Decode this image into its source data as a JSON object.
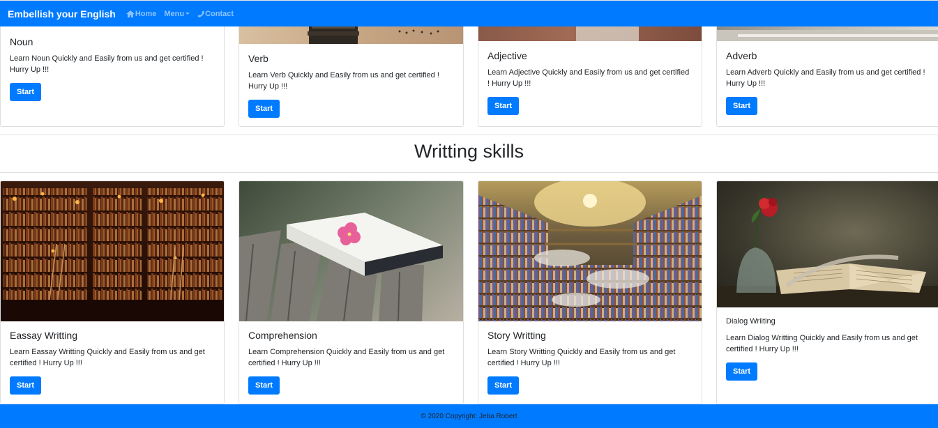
{
  "nav": {
    "brand": "Embellish your English",
    "links": [
      {
        "label": "Home",
        "icon": "home-icon"
      },
      {
        "label": "Menu",
        "icon": "caret-down-icon"
      },
      {
        "label": "Contact",
        "icon": "phone-icon"
      }
    ]
  },
  "grammar_cards": [
    {
      "title": "Noun",
      "text": "Learn Noun Quickly and Easily from us and get certified ! Hurry Up !!!",
      "button": "Start"
    },
    {
      "title": "Verb",
      "text": "Learn Verb Quickly and Easily from us and get certified ! Hurry Up !!!",
      "button": "Start"
    },
    {
      "title": "Adjective",
      "text": "Learn Adjective Quickly and Easily from us and get certified ! Hurry Up !!!",
      "button": "Start"
    },
    {
      "title": "Adverb",
      "text": "Learn Adverb Quickly and Easily from us and get certified ! Hurry Up !!!",
      "button": "Start"
    }
  ],
  "section_heading": "Writting skills",
  "writing_cards": [
    {
      "title": "Eassay Writting",
      "text": "Learn Eassay Writting Quickly and Easily from us and get certified ! Hurry Up !!!",
      "button": "Start"
    },
    {
      "title": "Comprehension",
      "text": "Learn Comprehension Quickly and Easily from us and get certified ! Hurry Up !!!",
      "button": "Start"
    },
    {
      "title": "Story Writting",
      "text": "Learn Story Writting Quickly and Easily from us and get certified ! Hurry Up !!!",
      "button": "Start"
    },
    {
      "title": "Dialog Wriiting",
      "text": "Learn Dialog Writting Quickly and Easily from us and get certified ! Hurry Up !!!",
      "button": "Start"
    }
  ],
  "footer": {
    "text": "© 2020 Copyright: Jeba Robert"
  },
  "colors": {
    "primary": "#007bff"
  }
}
